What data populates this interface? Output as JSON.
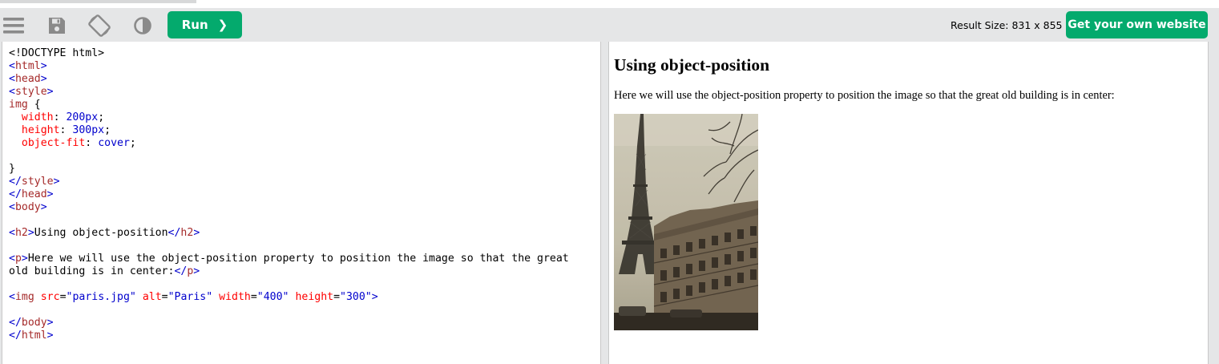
{
  "toolbar": {
    "icons": [
      "menu-icon",
      "save-icon",
      "rotate-icon",
      "contrast-icon"
    ],
    "run_label": "Run",
    "run_chevron": "❯",
    "result_size": "Result Size: 831 x 855",
    "own_website_label": "Get your own website"
  },
  "code_lines": [
    [
      {
        "c": "dt",
        "t": "<!DOCTYPE html>"
      }
    ],
    [
      {
        "c": "tg",
        "t": "<"
      },
      {
        "c": "tn",
        "t": "html"
      },
      {
        "c": "tg",
        "t": ">"
      }
    ],
    [
      {
        "c": "tg",
        "t": "<"
      },
      {
        "c": "tn",
        "t": "head"
      },
      {
        "c": "tg",
        "t": ">"
      }
    ],
    [
      {
        "c": "tg",
        "t": "<"
      },
      {
        "c": "tn",
        "t": "style"
      },
      {
        "c": "tg",
        "t": ">"
      }
    ],
    [
      {
        "c": "tn",
        "t": "img"
      },
      {
        "c": "dt",
        "t": " {"
      }
    ],
    [
      {
        "c": "dt",
        "t": "  "
      },
      {
        "c": "pr",
        "t": "width"
      },
      {
        "c": "dt",
        "t": ": "
      },
      {
        "c": "pv",
        "t": "200px"
      },
      {
        "c": "dt",
        "t": ";"
      }
    ],
    [
      {
        "c": "dt",
        "t": "  "
      },
      {
        "c": "pr",
        "t": "height"
      },
      {
        "c": "dt",
        "t": ": "
      },
      {
        "c": "pv",
        "t": "300px"
      },
      {
        "c": "dt",
        "t": ";"
      }
    ],
    [
      {
        "c": "dt",
        "t": "  "
      },
      {
        "c": "pr",
        "t": "object-fit"
      },
      {
        "c": "dt",
        "t": ": "
      },
      {
        "c": "pv",
        "t": "cover"
      },
      {
        "c": "dt",
        "t": ";"
      }
    ],
    [
      {
        "c": "dt",
        "t": ""
      }
    ],
    [
      {
        "c": "dt",
        "t": "}"
      }
    ],
    [
      {
        "c": "tg",
        "t": "</"
      },
      {
        "c": "tn",
        "t": "style"
      },
      {
        "c": "tg",
        "t": ">"
      }
    ],
    [
      {
        "c": "tg",
        "t": "</"
      },
      {
        "c": "tn",
        "t": "head"
      },
      {
        "c": "tg",
        "t": ">"
      }
    ],
    [
      {
        "c": "tg",
        "t": "<"
      },
      {
        "c": "tn",
        "t": "body"
      },
      {
        "c": "tg",
        "t": ">"
      }
    ],
    [
      {
        "c": "dt",
        "t": ""
      }
    ],
    [
      {
        "c": "tg",
        "t": "<"
      },
      {
        "c": "tn",
        "t": "h2"
      },
      {
        "c": "tg",
        "t": ">"
      },
      {
        "c": "dt",
        "t": "Using object-position"
      },
      {
        "c": "tg",
        "t": "</"
      },
      {
        "c": "tn",
        "t": "h2"
      },
      {
        "c": "tg",
        "t": ">"
      }
    ],
    [
      {
        "c": "dt",
        "t": ""
      }
    ],
    [
      {
        "c": "tg",
        "t": "<"
      },
      {
        "c": "tn",
        "t": "p"
      },
      {
        "c": "tg",
        "t": ">"
      },
      {
        "c": "dt",
        "t": "Here we will use the object-position property to position the image so that the great"
      }
    ],
    [
      {
        "c": "dt",
        "t": "old building is in center:"
      },
      {
        "c": "tg",
        "t": "</"
      },
      {
        "c": "tn",
        "t": "p"
      },
      {
        "c": "tg",
        "t": ">"
      }
    ],
    [
      {
        "c": "dt",
        "t": ""
      }
    ],
    [
      {
        "c": "tg",
        "t": "<"
      },
      {
        "c": "tn",
        "t": "img"
      },
      {
        "c": "dt",
        "t": " "
      },
      {
        "c": "an",
        "t": "src"
      },
      {
        "c": "dt",
        "t": "="
      },
      {
        "c": "av",
        "t": "\"paris.jpg\""
      },
      {
        "c": "dt",
        "t": " "
      },
      {
        "c": "an",
        "t": "alt"
      },
      {
        "c": "dt",
        "t": "="
      },
      {
        "c": "av",
        "t": "\"Paris\""
      },
      {
        "c": "dt",
        "t": " "
      },
      {
        "c": "an",
        "t": "width"
      },
      {
        "c": "dt",
        "t": "="
      },
      {
        "c": "av",
        "t": "\"400\""
      },
      {
        "c": "dt",
        "t": " "
      },
      {
        "c": "an",
        "t": "height"
      },
      {
        "c": "dt",
        "t": "="
      },
      {
        "c": "av",
        "t": "\"300\""
      },
      {
        "c": "tg",
        "t": ">"
      }
    ],
    [
      {
        "c": "dt",
        "t": ""
      }
    ],
    [
      {
        "c": "tg",
        "t": "</"
      },
      {
        "c": "tn",
        "t": "body"
      },
      {
        "c": "tg",
        "t": ">"
      }
    ],
    [
      {
        "c": "tg",
        "t": "</"
      },
      {
        "c": "tn",
        "t": "html"
      },
      {
        "c": "tg",
        "t": ">"
      }
    ]
  ],
  "result": {
    "heading": "Using object-position",
    "paragraph": "Here we will use the object-position property to position the image so that the great old building is in center:",
    "image_alt": "Paris"
  },
  "colors": {
    "brand_green": "#04aa6d",
    "tag": "#0000cd",
    "tag_name": "#a52a2a",
    "attr_name": "#ff0000",
    "attr_value": "#0000cd"
  }
}
